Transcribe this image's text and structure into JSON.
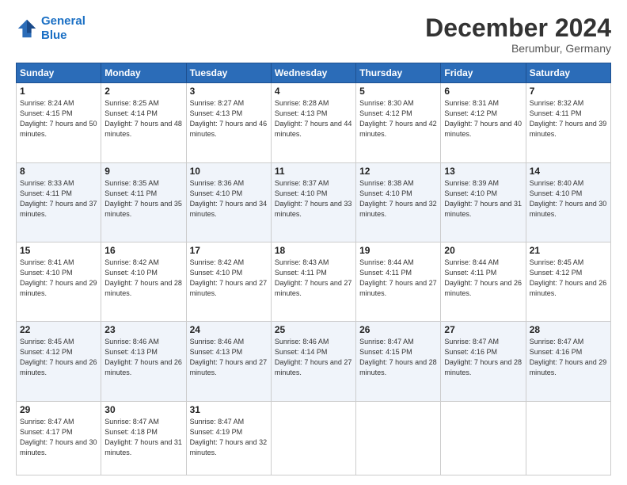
{
  "logo": {
    "line1": "General",
    "line2": "Blue"
  },
  "title": "December 2024",
  "location": "Berumbur, Germany",
  "days_header": [
    "Sunday",
    "Monday",
    "Tuesday",
    "Wednesday",
    "Thursday",
    "Friday",
    "Saturday"
  ],
  "weeks": [
    [
      {
        "day": "1",
        "sunrise": "Sunrise: 8:24 AM",
        "sunset": "Sunset: 4:15 PM",
        "daylight": "Daylight: 7 hours and 50 minutes."
      },
      {
        "day": "2",
        "sunrise": "Sunrise: 8:25 AM",
        "sunset": "Sunset: 4:14 PM",
        "daylight": "Daylight: 7 hours and 48 minutes."
      },
      {
        "day": "3",
        "sunrise": "Sunrise: 8:27 AM",
        "sunset": "Sunset: 4:13 PM",
        "daylight": "Daylight: 7 hours and 46 minutes."
      },
      {
        "day": "4",
        "sunrise": "Sunrise: 8:28 AM",
        "sunset": "Sunset: 4:13 PM",
        "daylight": "Daylight: 7 hours and 44 minutes."
      },
      {
        "day": "5",
        "sunrise": "Sunrise: 8:30 AM",
        "sunset": "Sunset: 4:12 PM",
        "daylight": "Daylight: 7 hours and 42 minutes."
      },
      {
        "day": "6",
        "sunrise": "Sunrise: 8:31 AM",
        "sunset": "Sunset: 4:12 PM",
        "daylight": "Daylight: 7 hours and 40 minutes."
      },
      {
        "day": "7",
        "sunrise": "Sunrise: 8:32 AM",
        "sunset": "Sunset: 4:11 PM",
        "daylight": "Daylight: 7 hours and 39 minutes."
      }
    ],
    [
      {
        "day": "8",
        "sunrise": "Sunrise: 8:33 AM",
        "sunset": "Sunset: 4:11 PM",
        "daylight": "Daylight: 7 hours and 37 minutes."
      },
      {
        "day": "9",
        "sunrise": "Sunrise: 8:35 AM",
        "sunset": "Sunset: 4:11 PM",
        "daylight": "Daylight: 7 hours and 35 minutes."
      },
      {
        "day": "10",
        "sunrise": "Sunrise: 8:36 AM",
        "sunset": "Sunset: 4:10 PM",
        "daylight": "Daylight: 7 hours and 34 minutes."
      },
      {
        "day": "11",
        "sunrise": "Sunrise: 8:37 AM",
        "sunset": "Sunset: 4:10 PM",
        "daylight": "Daylight: 7 hours and 33 minutes."
      },
      {
        "day": "12",
        "sunrise": "Sunrise: 8:38 AM",
        "sunset": "Sunset: 4:10 PM",
        "daylight": "Daylight: 7 hours and 32 minutes."
      },
      {
        "day": "13",
        "sunrise": "Sunrise: 8:39 AM",
        "sunset": "Sunset: 4:10 PM",
        "daylight": "Daylight: 7 hours and 31 minutes."
      },
      {
        "day": "14",
        "sunrise": "Sunrise: 8:40 AM",
        "sunset": "Sunset: 4:10 PM",
        "daylight": "Daylight: 7 hours and 30 minutes."
      }
    ],
    [
      {
        "day": "15",
        "sunrise": "Sunrise: 8:41 AM",
        "sunset": "Sunset: 4:10 PM",
        "daylight": "Daylight: 7 hours and 29 minutes."
      },
      {
        "day": "16",
        "sunrise": "Sunrise: 8:42 AM",
        "sunset": "Sunset: 4:10 PM",
        "daylight": "Daylight: 7 hours and 28 minutes."
      },
      {
        "day": "17",
        "sunrise": "Sunrise: 8:42 AM",
        "sunset": "Sunset: 4:10 PM",
        "daylight": "Daylight: 7 hours and 27 minutes."
      },
      {
        "day": "18",
        "sunrise": "Sunrise: 8:43 AM",
        "sunset": "Sunset: 4:11 PM",
        "daylight": "Daylight: 7 hours and 27 minutes."
      },
      {
        "day": "19",
        "sunrise": "Sunrise: 8:44 AM",
        "sunset": "Sunset: 4:11 PM",
        "daylight": "Daylight: 7 hours and 27 minutes."
      },
      {
        "day": "20",
        "sunrise": "Sunrise: 8:44 AM",
        "sunset": "Sunset: 4:11 PM",
        "daylight": "Daylight: 7 hours and 26 minutes."
      },
      {
        "day": "21",
        "sunrise": "Sunrise: 8:45 AM",
        "sunset": "Sunset: 4:12 PM",
        "daylight": "Daylight: 7 hours and 26 minutes."
      }
    ],
    [
      {
        "day": "22",
        "sunrise": "Sunrise: 8:45 AM",
        "sunset": "Sunset: 4:12 PM",
        "daylight": "Daylight: 7 hours and 26 minutes."
      },
      {
        "day": "23",
        "sunrise": "Sunrise: 8:46 AM",
        "sunset": "Sunset: 4:13 PM",
        "daylight": "Daylight: 7 hours and 26 minutes."
      },
      {
        "day": "24",
        "sunrise": "Sunrise: 8:46 AM",
        "sunset": "Sunset: 4:13 PM",
        "daylight": "Daylight: 7 hours and 27 minutes."
      },
      {
        "day": "25",
        "sunrise": "Sunrise: 8:46 AM",
        "sunset": "Sunset: 4:14 PM",
        "daylight": "Daylight: 7 hours and 27 minutes."
      },
      {
        "day": "26",
        "sunrise": "Sunrise: 8:47 AM",
        "sunset": "Sunset: 4:15 PM",
        "daylight": "Daylight: 7 hours and 28 minutes."
      },
      {
        "day": "27",
        "sunrise": "Sunrise: 8:47 AM",
        "sunset": "Sunset: 4:16 PM",
        "daylight": "Daylight: 7 hours and 28 minutes."
      },
      {
        "day": "28",
        "sunrise": "Sunrise: 8:47 AM",
        "sunset": "Sunset: 4:16 PM",
        "daylight": "Daylight: 7 hours and 29 minutes."
      }
    ],
    [
      {
        "day": "29",
        "sunrise": "Sunrise: 8:47 AM",
        "sunset": "Sunset: 4:17 PM",
        "daylight": "Daylight: 7 hours and 30 minutes."
      },
      {
        "day": "30",
        "sunrise": "Sunrise: 8:47 AM",
        "sunset": "Sunset: 4:18 PM",
        "daylight": "Daylight: 7 hours and 31 minutes."
      },
      {
        "day": "31",
        "sunrise": "Sunrise: 8:47 AM",
        "sunset": "Sunset: 4:19 PM",
        "daylight": "Daylight: 7 hours and 32 minutes."
      },
      null,
      null,
      null,
      null
    ]
  ]
}
